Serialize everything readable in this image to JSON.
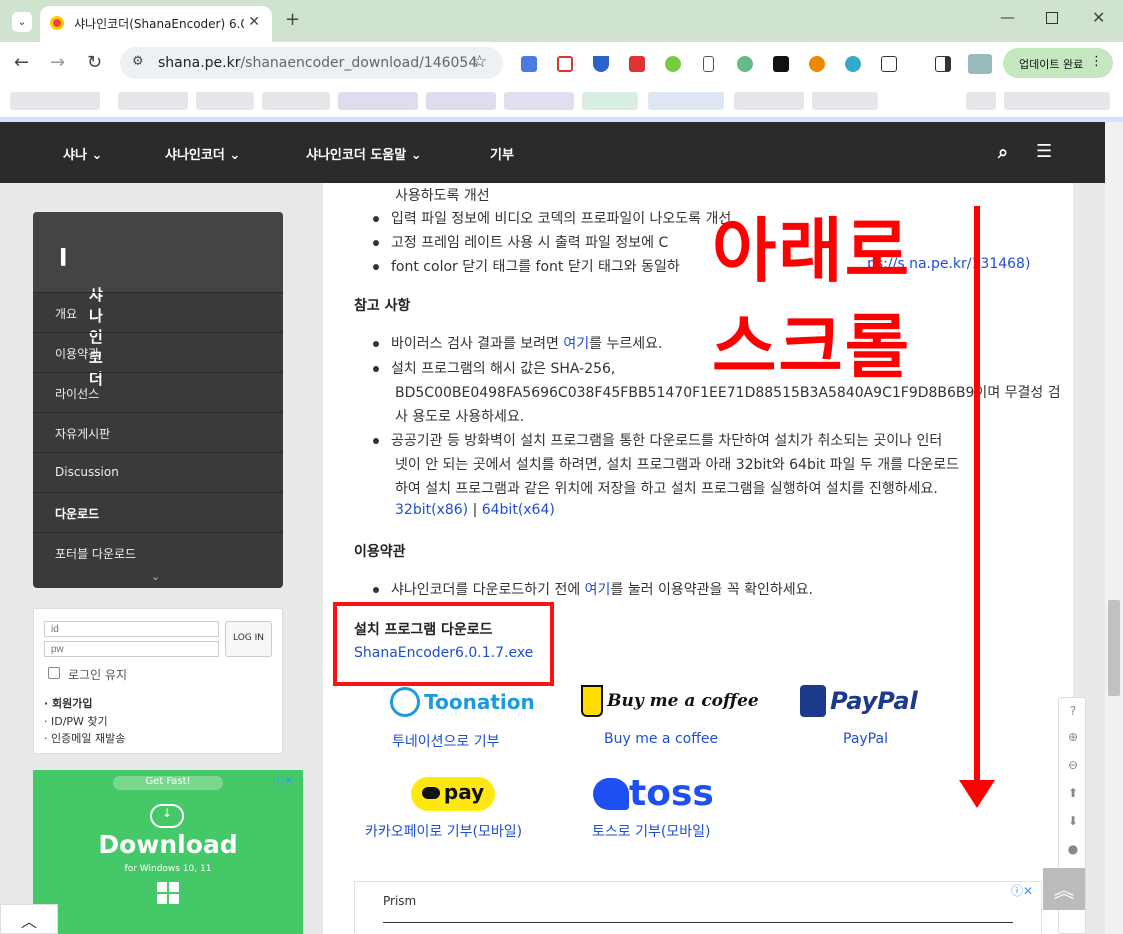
{
  "browser": {
    "tab_title": "샤나인코더(ShanaEncoder) 6.0.",
    "url_host": "shana.pe.kr",
    "url_path": "/shanaencoder_download/146054",
    "update_label": "업데이트 완료"
  },
  "nav": {
    "items": [
      "샤나",
      "샤나인코더",
      "샤나인코더 도움말",
      "기부"
    ]
  },
  "sidebar": {
    "title": "샤나인코더",
    "items": [
      "개요",
      "이용약관",
      "라이선스",
      "자유게시판",
      "Discussion",
      "다운로드",
      "포터블 다운로드"
    ],
    "login": {
      "id_placeholder": "id",
      "pw_placeholder": "pw",
      "login_button": "LOG IN",
      "keep_login": "로그인 유지",
      "links": [
        "회원가입",
        "ID/PW 찾기",
        "인증메일 재발송"
      ]
    },
    "ad": {
      "badge": "Get Fast!",
      "title": "Download",
      "subtitle": "for Windows 10, 11"
    }
  },
  "content": {
    "line0": "사용하도록 개선",
    "changes": [
      "입력 파일 정보에 비디오 코덱의 프로파일이 나오도록 개선",
      "고정 프레임 레이트 사용 시 출력 파일 정보에 C",
      "font color 닫기 태그를 font 닫기 태그와 동일하"
    ],
    "changes_link": "ps://s  na.pe.kr/131468)",
    "ref_title": "참고 사항",
    "ref1_a": "바이러스 검사 결과를 보려면 ",
    "ref1_link": "여기",
    "ref1_b": "를 누르세요.",
    "ref2_line1": "설치 프로그램의 해시 값은 SHA-256,",
    "ref2_line2": "BD5C00BE0498FA5696C038F45FBB51470F1EE71D88515B3A5840A9C1F9D8B6B9이며 무결성 검",
    "ref2_line3": "사 용도로 사용하세요.",
    "ref3_line1": "공공기관 등 방화벽이 설치 프로그램을 통한 다운로드를 차단하여 설치가 취소되는 곳이나 인터",
    "ref3_line2": "넷이 안 되는 곳에서 설치를 하려면, 설치 프로그램과 아래 32bit와 64bit 파일 두 개를 다운로드",
    "ref3_line3": "하여 설치 프로그램과 같은 위치에 저장을 하고 설치 프로그램을 실행하여 설치를 진행하세요.",
    "link32": "32bit(x86)",
    "sep": "|",
    "link64": "64bit(x64)",
    "terms_title": "이용약관",
    "terms_a": "샤나인코더를 다운로드하기 전에 ",
    "terms_link": "여기",
    "terms_b": "를 눌러 이용약관을 꼭 확인하세요.",
    "install_title": "설치 프로그램 다운로드",
    "install_file": "ShanaEncoder6.0.1.7.exe",
    "overlay_line1": "아래로",
    "overlay_line2": "스크롤",
    "donations": [
      {
        "logo": "Toonation",
        "label": "투네이션으로 기부"
      },
      {
        "logo": "Buy me a coffee",
        "label": "Buy me a coffee"
      },
      {
        "logo": "PayPal",
        "label": "PayPal"
      },
      {
        "logo": "pay",
        "label": "카카오페이로 기부(모바일)"
      },
      {
        "logo": "toss",
        "label": "토스로 기부(모바일)"
      }
    ],
    "ad_title": "Prism"
  },
  "colors": {
    "accent_link": "#1e4fd1",
    "highlight": "#ff1111",
    "nav_bg": "#2b2b2b"
  }
}
